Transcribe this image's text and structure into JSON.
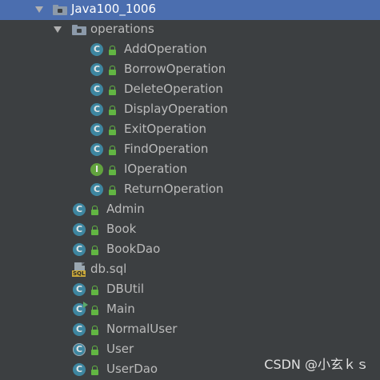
{
  "project": {
    "name": "Java100_1006",
    "package": "operations",
    "package_classes": [
      {
        "label": "AddOperation",
        "kind": "class",
        "glyph": "C"
      },
      {
        "label": "BorrowOperation",
        "kind": "class",
        "glyph": "C"
      },
      {
        "label": "DeleteOperation",
        "kind": "class",
        "glyph": "C"
      },
      {
        "label": "DisplayOperation",
        "kind": "class",
        "glyph": "C"
      },
      {
        "label": "ExitOperation",
        "kind": "class",
        "glyph": "C"
      },
      {
        "label": "FindOperation",
        "kind": "class",
        "glyph": "C"
      },
      {
        "label": "IOperation",
        "kind": "interface",
        "glyph": "I"
      },
      {
        "label": "ReturnOperation",
        "kind": "class",
        "glyph": "C"
      }
    ],
    "root_items": [
      {
        "label": "Admin",
        "kind": "class",
        "glyph": "C"
      },
      {
        "label": "Book",
        "kind": "class",
        "glyph": "C"
      },
      {
        "label": "BookDao",
        "kind": "class",
        "glyph": "C"
      },
      {
        "label": "db.sql",
        "kind": "sql",
        "tag": "SQL"
      },
      {
        "label": "DBUtil",
        "kind": "class",
        "glyph": "C"
      },
      {
        "label": "Main",
        "kind": "runnable-class",
        "glyph": "C"
      },
      {
        "label": "NormalUser",
        "kind": "class",
        "glyph": "C"
      },
      {
        "label": "User",
        "kind": "abstract-class",
        "glyph": "C"
      },
      {
        "label": "UserDao",
        "kind": "class",
        "glyph": "C"
      }
    ]
  },
  "colors": {
    "background": "#3c3f41",
    "selection": "#4b6eaf",
    "class_icon": "#3e86a0",
    "interface_icon": "#62a33e",
    "lock": "#62b543"
  },
  "watermark": "CSDN @小玄ｋｓ"
}
